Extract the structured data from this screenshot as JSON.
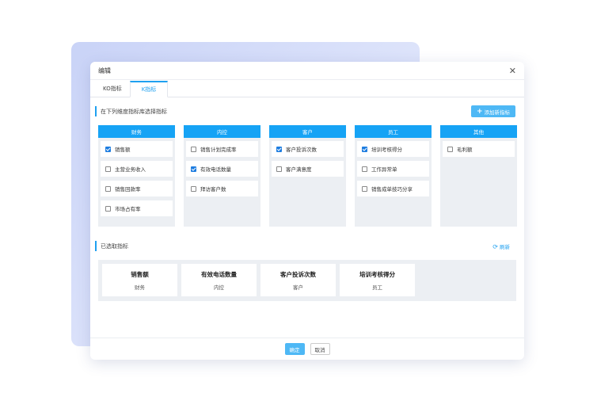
{
  "dialog": {
    "title": "编辑",
    "close_glyph": "✕"
  },
  "tabs": [
    {
      "label": "KO指标",
      "active": false
    },
    {
      "label": "K指标",
      "active": true
    }
  ],
  "pick_section": {
    "label": "在下列维度指标库选择指标",
    "add_button": "添加新指标"
  },
  "categories": [
    {
      "name": "财务",
      "items": [
        {
          "label": "销售额",
          "checked": true
        },
        {
          "label": "主营业务收入",
          "checked": false
        },
        {
          "label": "销售回款率",
          "checked": false
        },
        {
          "label": "市场占有率",
          "checked": false
        }
      ]
    },
    {
      "name": "内控",
      "items": [
        {
          "label": "销售计划完成率",
          "checked": false
        },
        {
          "label": "有效电话数量",
          "checked": true
        },
        {
          "label": "拜访客户数",
          "checked": false
        }
      ]
    },
    {
      "name": "客户",
      "items": [
        {
          "label": "客户投诉次数",
          "checked": true
        },
        {
          "label": "客户满意度",
          "checked": false
        }
      ]
    },
    {
      "name": "员工",
      "items": [
        {
          "label": "培训考核得分",
          "checked": true
        },
        {
          "label": "工作异常单",
          "checked": false
        },
        {
          "label": "销售成单技巧分享",
          "checked": false
        }
      ]
    },
    {
      "name": "其他",
      "items": [
        {
          "label": "毛利额",
          "checked": false
        }
      ]
    }
  ],
  "selected_section": {
    "label": "已选取指标",
    "refresh": "刷新",
    "cards": [
      {
        "name": "销售额",
        "category": "财务"
      },
      {
        "name": "有效电话数量",
        "category": "内控"
      },
      {
        "name": "客户投诉次数",
        "category": "客户"
      },
      {
        "name": "培训考核得分",
        "category": "员工"
      }
    ]
  },
  "footer": {
    "ok": "确定",
    "cancel": "取消"
  },
  "colors": {
    "accent": "#1fa0f0",
    "column_header": "#16a3f5",
    "checkbox_checked": "#1e7de0"
  }
}
